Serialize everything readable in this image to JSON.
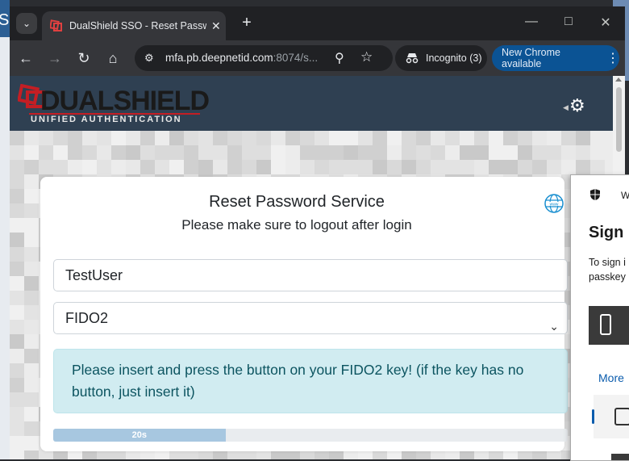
{
  "desktop": {
    "left_text": "S"
  },
  "browser": {
    "tab": {
      "title": "DualShield SSO - Reset Password"
    },
    "address": {
      "host": "mfa.pb.deepnetid.com",
      "rest": ":8074/s..."
    },
    "incognito_label": "Incognito (3)",
    "update_label": "New Chrome available"
  },
  "header": {
    "logo_dual": "DUAL",
    "logo_shield": "SHIELD",
    "logo_tagline": "UNIFIED AUTHENTICATION"
  },
  "card": {
    "title": "Reset Password Service",
    "subtitle": "Please make sure to logout after login",
    "username_value": "TestUser",
    "method_selected": "FIDO2",
    "alert_text": "Please insert and press the button on your FIDO2 key! (if the key has no button, just insert it)",
    "progress": {
      "label": "20s",
      "percent": 33.5
    }
  },
  "dialog": {
    "brand": "W",
    "title": "Sign i",
    "desc_line1": "To sign i",
    "desc_line2": "passkey",
    "more_label": "More"
  },
  "colors": {
    "header_bg": "#2f4052",
    "brand_red": "#c41e24",
    "alert_bg": "#d1ecf1",
    "alert_text": "#0c5460",
    "progress_fill": "#a7c7e0",
    "update_bg": "#0b5394"
  }
}
